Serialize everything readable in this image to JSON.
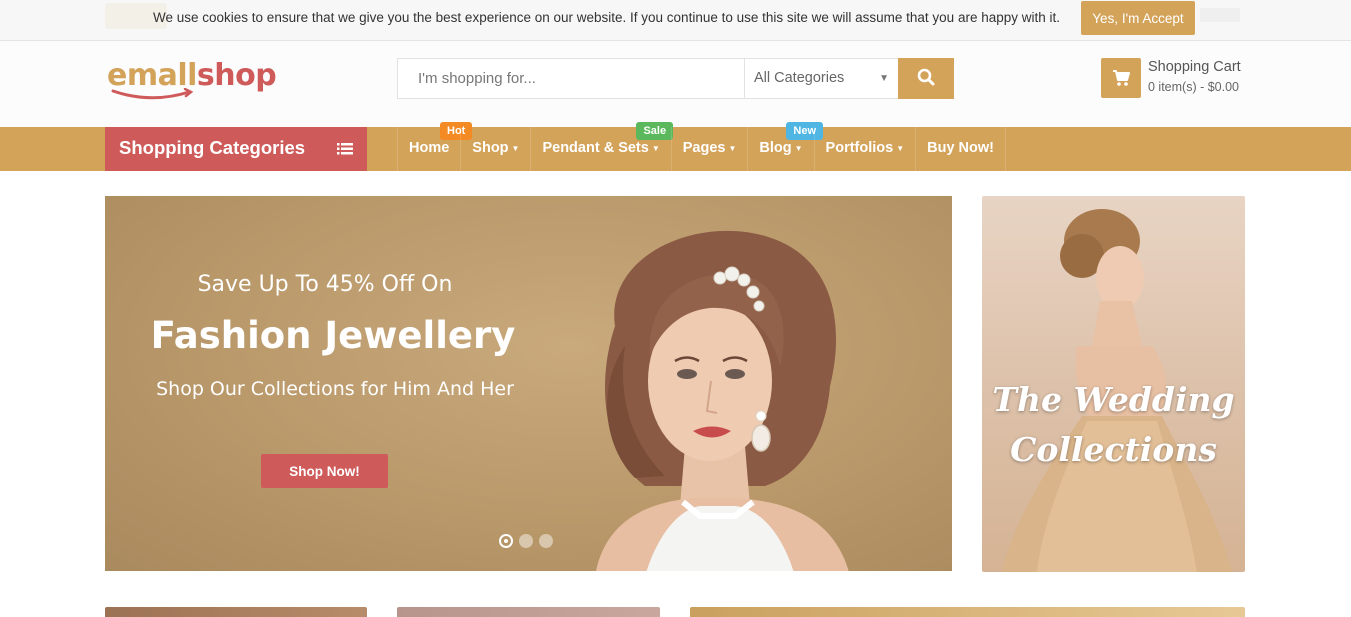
{
  "cookie_bar": {
    "message": "We use cookies to ensure that we give you the best experience on our website. If you continue to use this site we will assume that you are happy with it.",
    "accept_label": "Yes, I'm Accept"
  },
  "header": {
    "logo": {
      "part1": "emall",
      "part2": "shop"
    },
    "search": {
      "placeholder": "I'm shopping for...",
      "category": "All Categories"
    },
    "cart": {
      "title": "Shopping Cart",
      "summary": "0 item(s) - $0.00"
    }
  },
  "nav": {
    "categories_label": "Shopping Categories",
    "items": [
      {
        "label": "Home",
        "badge": "Hot"
      },
      {
        "label": "Shop"
      },
      {
        "label": "Pendant & Sets",
        "badge": "Sale"
      },
      {
        "label": "Pages"
      },
      {
        "label": "Blog",
        "badge": "New"
      },
      {
        "label": "Portfolios"
      },
      {
        "label": "Buy Now!"
      }
    ]
  },
  "hero": {
    "pretitle": "Save Up To 45% Off On",
    "title": "Fashion Jewellery",
    "subtitle": "Shop Our Collections for Him And Her",
    "button": "Shop Now!"
  },
  "side_banner": {
    "line1": "The Wedding",
    "line2": "Collections"
  },
  "colors": {
    "gold": "#d4a35a",
    "red": "#cf5a5a",
    "hot_badge": "#f48a23",
    "sale_badge": "#5cb85c",
    "new_badge": "#4fb6e3"
  }
}
